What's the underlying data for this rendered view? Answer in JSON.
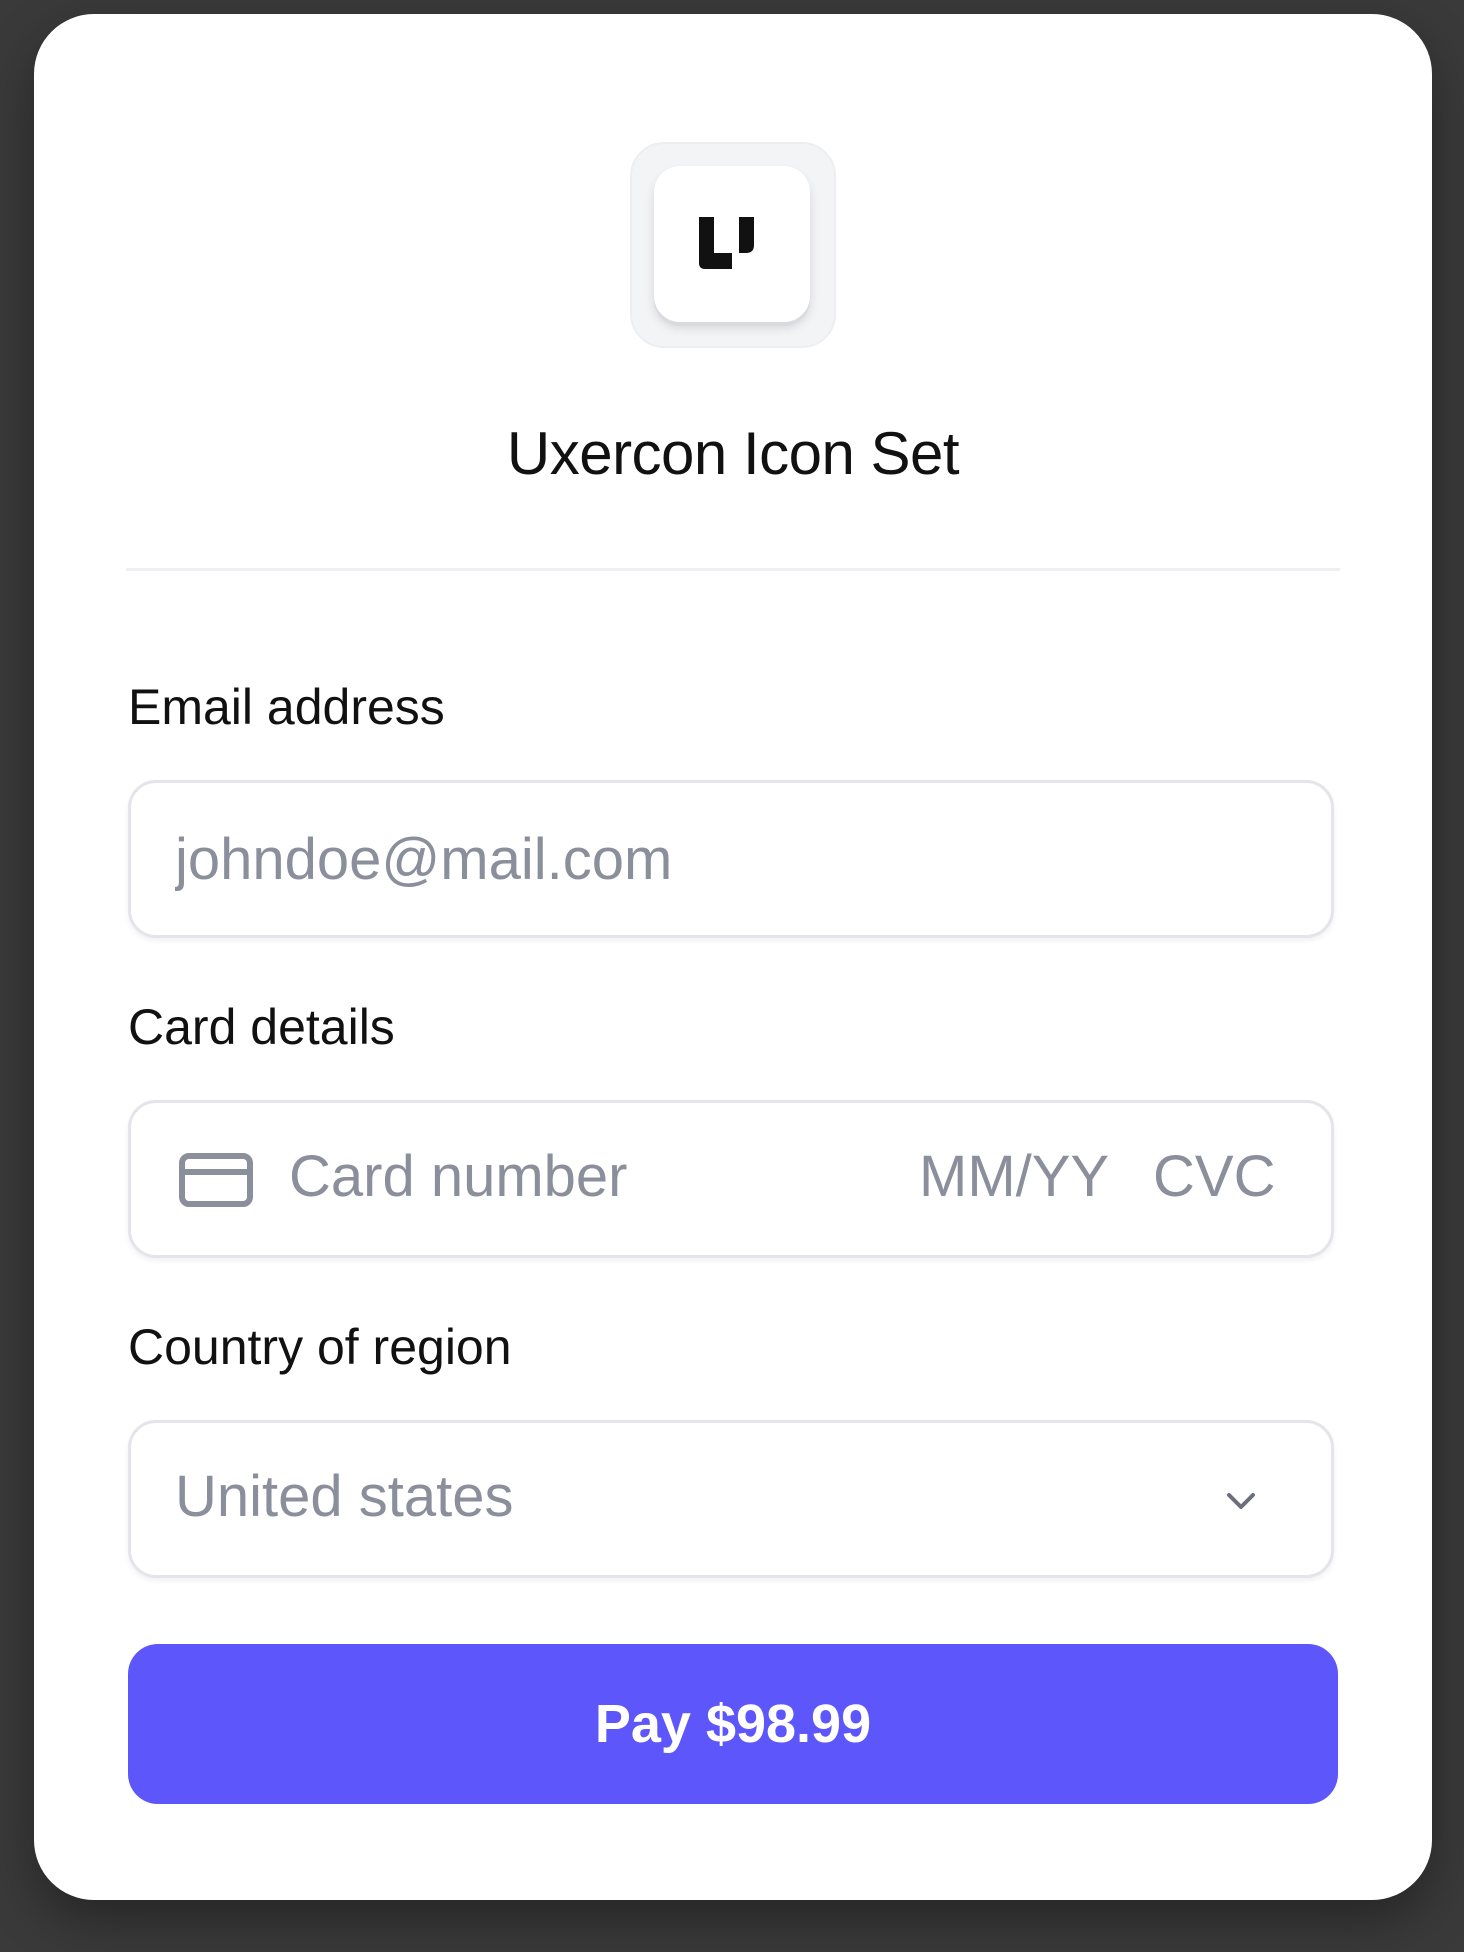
{
  "app": {
    "title": "Uxercon Icon Set",
    "logo_icon": "uxercon-logo-icon"
  },
  "form": {
    "email": {
      "label": "Email address",
      "placeholder": "johndoe@mail.com",
      "value": ""
    },
    "card": {
      "label": "Card details",
      "icon": "credit-card-icon",
      "number_placeholder": "Card number",
      "expiry_placeholder": "MM/YY",
      "cvc_placeholder": "CVC"
    },
    "country": {
      "label": "Country of region",
      "selected": "United states",
      "icon": "chevron-down-icon"
    },
    "pay_button": {
      "label": "Pay $98.99"
    }
  },
  "colors": {
    "accent": "#5d57fb",
    "placeholder": "#8b8f9c",
    "text": "#111111",
    "field_border": "#e3e5ea"
  }
}
